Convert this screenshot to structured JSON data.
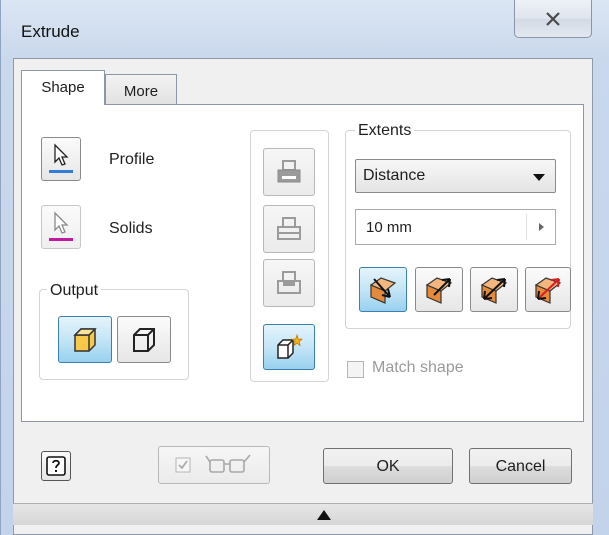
{
  "window": {
    "title": "Extrude"
  },
  "tabs": [
    {
      "label": "Shape",
      "selected": true
    },
    {
      "label": "More",
      "selected": false
    }
  ],
  "selection": {
    "profile_label": "Profile",
    "solids_label": "Solids",
    "profile_underline_color": "#2f7fd8",
    "solids_underline_color": "#c01aa0"
  },
  "output": {
    "legend": "Output",
    "buttons": [
      {
        "name": "solid-output",
        "active": true
      },
      {
        "name": "surface-output",
        "active": false
      }
    ]
  },
  "operations": [
    "join",
    "cut",
    "intersect",
    "new-solid"
  ],
  "extents": {
    "legend": "Extents",
    "type": "Distance",
    "distance": "10 mm",
    "direction_buttons": [
      {
        "name": "direction-1",
        "active": true
      },
      {
        "name": "direction-2",
        "active": false
      },
      {
        "name": "symmetric",
        "active": false
      },
      {
        "name": "asymmetric",
        "active": false
      }
    ]
  },
  "match_shape": {
    "label": "Match shape",
    "checked": false,
    "enabled": false
  },
  "footer": {
    "ok_label": "OK",
    "cancel_label": "Cancel",
    "preview_checked": true
  },
  "colors": {
    "active_button": "#98d1ef",
    "window_frame": "#c9d8ec"
  }
}
